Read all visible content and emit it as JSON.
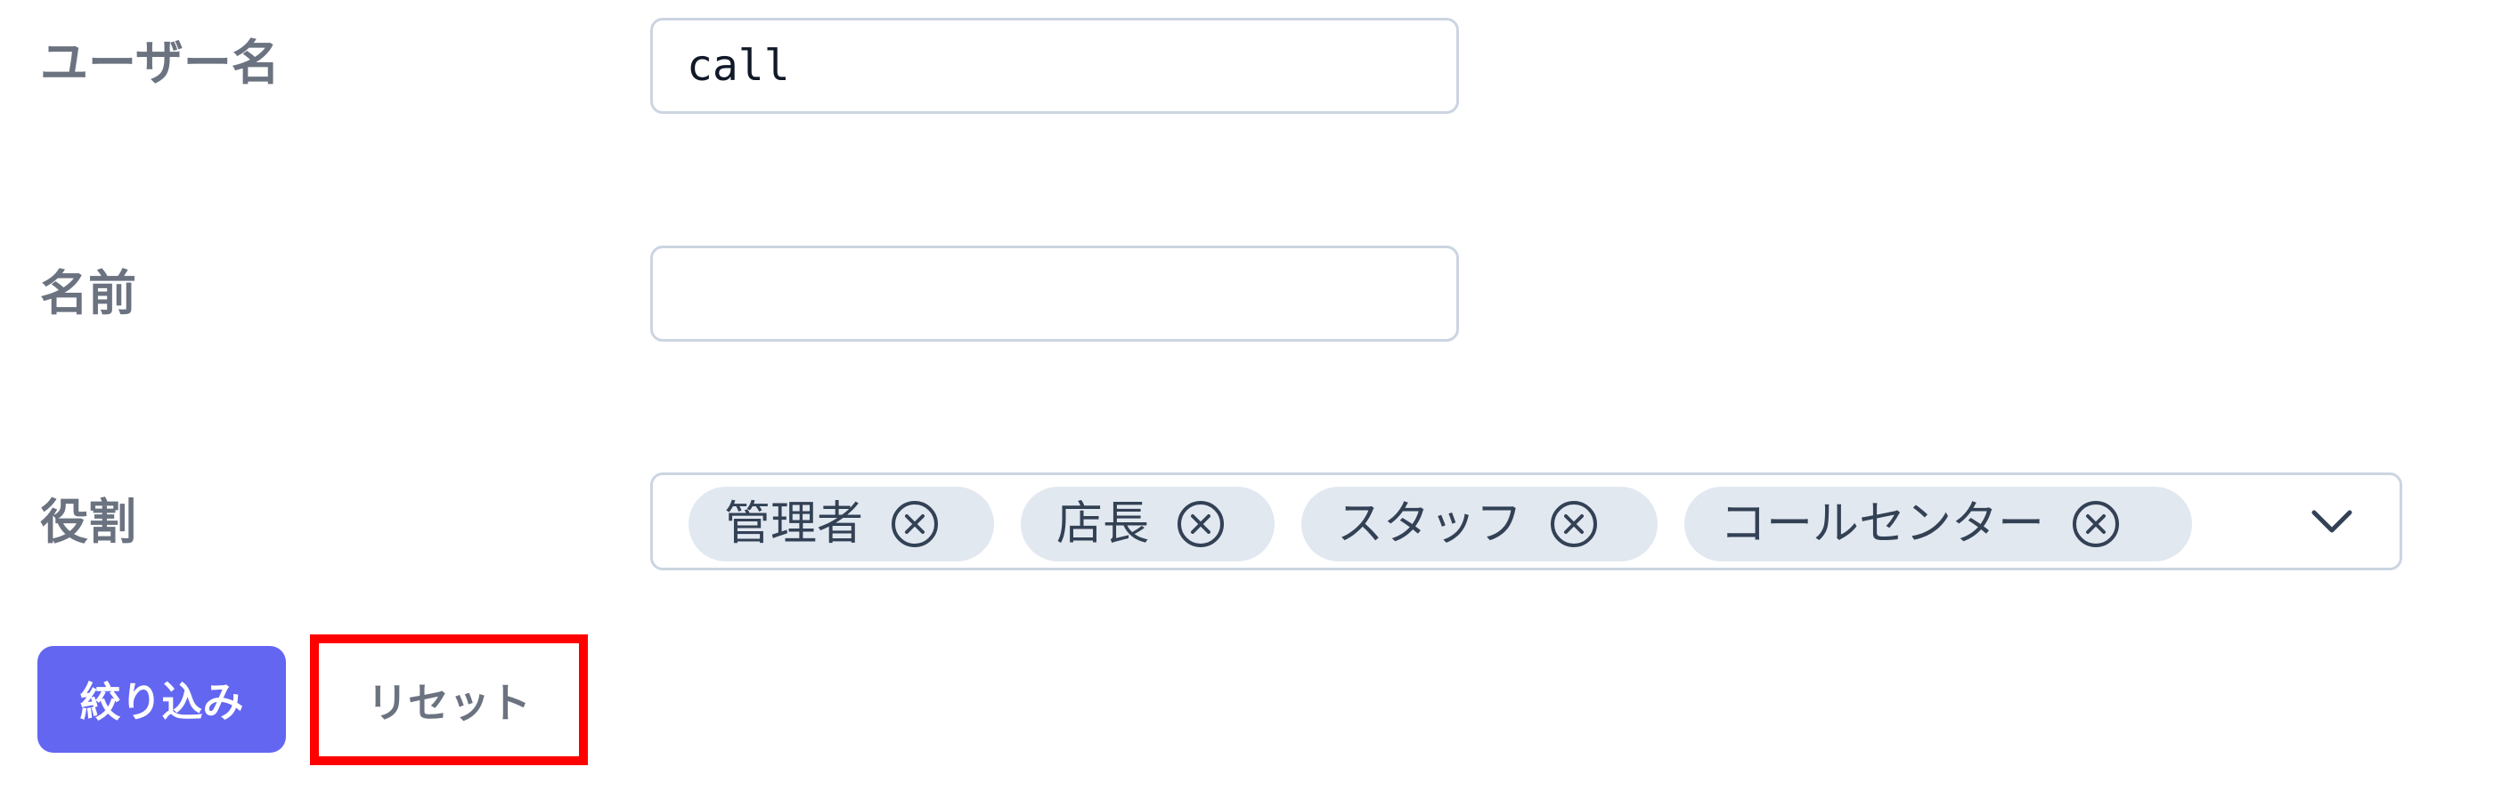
{
  "form": {
    "username": {
      "label": "ユーザー名",
      "value": "call"
    },
    "name": {
      "label": "名前",
      "value": ""
    },
    "roles": {
      "label": "役割",
      "tags": [
        "管理者",
        "店長",
        "スタッフ",
        "コールセンター"
      ],
      "remove_icon": "circle-x-icon",
      "dropdown_icon": "chevron-down-icon"
    }
  },
  "actions": {
    "filter_label": "絞り込み",
    "reset_label": "リセット"
  },
  "colors": {
    "primary": "#6366f1",
    "label_text": "#6b7280",
    "tag_bg": "#e2e8f0",
    "highlight": "#ff0000"
  }
}
